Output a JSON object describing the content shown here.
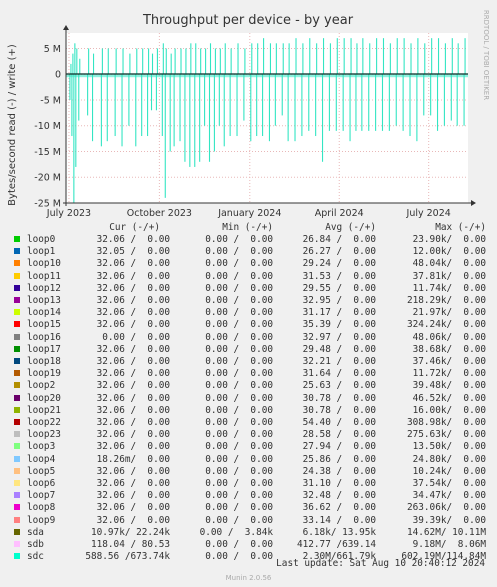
{
  "chart_data": {
    "type": "area",
    "title": "Throughput per device - by year",
    "ylabel": "Bytes/second read (-) / write (+)",
    "side_label": "RRDTOOL / TOBI OETIKER",
    "ylim": [
      -25000000,
      8000000
    ],
    "y_ticks": [
      {
        "value": 5000000,
        "label": "5 M"
      },
      {
        "value": 0,
        "label": "0"
      },
      {
        "value": -5000000,
        "label": "-5 M"
      },
      {
        "value": -10000000,
        "label": "-10 M"
      },
      {
        "value": -15000000,
        "label": "-15 M"
      },
      {
        "value": -20000000,
        "label": "-20 M"
      },
      {
        "value": -25000000,
        "label": "-25 M"
      }
    ],
    "x_ticks": [
      {
        "date": "2023-07-01",
        "label": "July 2023"
      },
      {
        "date": "2023-10-01",
        "label": "October 2023"
      },
      {
        "date": "2024-01-01",
        "label": "January 2024"
      },
      {
        "date": "2024-04-01",
        "label": "April 2024"
      },
      {
        "date": "2024-07-01",
        "label": "July 2024"
      }
    ],
    "x_range": [
      "2023-06-28",
      "2024-08-10"
    ],
    "series_color": "#33e5c3",
    "series": [
      {
        "name": "sdc",
        "dates": [
          "2023-07-02",
          "2023-07-04",
          "2023-07-06",
          "2023-07-08",
          "2023-07-11",
          "2023-07-20",
          "2023-07-25",
          "2023-08-03",
          "2023-08-09",
          "2023-08-17",
          "2023-08-24",
          "2023-08-31",
          "2023-09-07",
          "2023-09-13",
          "2023-09-19",
          "2023-09-23",
          "2023-09-28",
          "2023-10-04",
          "2023-10-07",
          "2023-10-12",
          "2023-10-16",
          "2023-10-22",
          "2023-10-27",
          "2023-11-01",
          "2023-11-06",
          "2023-11-11",
          "2023-11-16",
          "2023-11-21",
          "2023-11-26",
          "2023-12-01",
          "2023-12-06",
          "2023-12-12",
          "2023-12-19",
          "2023-12-26",
          "2024-01-02",
          "2024-01-08",
          "2024-01-14",
          "2024-01-21",
          "2024-01-27",
          "2024-02-03",
          "2024-02-09",
          "2024-02-16",
          "2024-02-23",
          "2024-03-01",
          "2024-03-08",
          "2024-03-15",
          "2024-03-22",
          "2024-03-29",
          "2024-04-05",
          "2024-04-12",
          "2024-04-18",
          "2024-04-24",
          "2024-05-01",
          "2024-05-08",
          "2024-05-15",
          "2024-05-22",
          "2024-05-29",
          "2024-06-05",
          "2024-06-12",
          "2024-06-19",
          "2024-06-26",
          "2024-07-03",
          "2024-07-10",
          "2024-07-17",
          "2024-07-24",
          "2024-07-30",
          "2024-08-06"
        ],
        "read": [
          -5000000,
          -12000000,
          -25000000,
          -18000000,
          -9000000,
          -8000000,
          -13000000,
          -14000000,
          -13000000,
          -12000000,
          -14000000,
          -10000000,
          -14000000,
          -12000000,
          -12000000,
          -7000000,
          -7000000,
          -12000000,
          -24000000,
          -15000000,
          -14000000,
          -13000000,
          -17000000,
          -18000000,
          -18000000,
          -17000000,
          -10000000,
          -17000000,
          -15000000,
          -10000000,
          -14000000,
          -12000000,
          -12000000,
          -9000000,
          -13000000,
          -12000000,
          -12000000,
          -13000000,
          -10000000,
          -8000000,
          -13000000,
          -13000000,
          -12000000,
          -11000000,
          -12000000,
          -17000000,
          -11000000,
          -11000000,
          -11000000,
          -13000000,
          -11000000,
          -11000000,
          -11000000,
          -11000000,
          -11000000,
          -11000000,
          -10000000,
          -11000000,
          -12000000,
          -13000000,
          -8000000,
          -8000000,
          -11000000,
          -10000000,
          -9000000,
          -10000000,
          -10000000
        ],
        "write": [
          2000000,
          4000000,
          6000000,
          5000000,
          3000000,
          5000000,
          4000000,
          5000000,
          5000000,
          5000000,
          5000000,
          4000000,
          5000000,
          5000000,
          5000000,
          4000000,
          5000000,
          6000000,
          5000000,
          4000000,
          5000000,
          5000000,
          5000000,
          6000000,
          6000000,
          5000000,
          5000000,
          6000000,
          5000000,
          5000000,
          6000000,
          5000000,
          6000000,
          5000000,
          6000000,
          6000000,
          7000000,
          6000000,
          6000000,
          6000000,
          6000000,
          7000000,
          6000000,
          7000000,
          6000000,
          7000000,
          6000000,
          7000000,
          7000000,
          7000000,
          6000000,
          7000000,
          6000000,
          7000000,
          7000000,
          6000000,
          7000000,
          7000000,
          6000000,
          7000000,
          6000000,
          7000000,
          7000000,
          6000000,
          7000000,
          6000000,
          7000000
        ]
      }
    ]
  },
  "legend": {
    "headers": {
      "cur": "Cur (-/+)",
      "min": "Min (-/+)",
      "avg": "Avg (-/+)",
      "max": "Max (-/+)"
    },
    "rows": [
      {
        "name": "loop0",
        "color": "#00cc00",
        "cur": "32.06 /  0.00",
        "min": "0.00 /  0.00",
        "avg": "26.84 /  0.00",
        "max": "23.90k/  0.00"
      },
      {
        "name": "loop1",
        "color": "#0066b3",
        "cur": "32.05 /  0.00",
        "min": "0.00 /  0.00",
        "avg": "26.27 /  0.00",
        "max": "12.00k/  0.00"
      },
      {
        "name": "loop10",
        "color": "#ff8000",
        "cur": "32.06 /  0.00",
        "min": "0.00 /  0.00",
        "avg": "29.24 /  0.00",
        "max": "48.04k/  0.00"
      },
      {
        "name": "loop11",
        "color": "#ffcc00",
        "cur": "32.06 /  0.00",
        "min": "0.00 /  0.00",
        "avg": "31.53 /  0.00",
        "max": "37.81k/  0.00"
      },
      {
        "name": "loop12",
        "color": "#330099",
        "cur": "32.06 /  0.00",
        "min": "0.00 /  0.00",
        "avg": "29.55 /  0.00",
        "max": "11.74k/  0.00"
      },
      {
        "name": "loop13",
        "color": "#990099",
        "cur": "32.06 /  0.00",
        "min": "0.00 /  0.00",
        "avg": "32.95 /  0.00",
        "max": "218.29k/  0.00"
      },
      {
        "name": "loop14",
        "color": "#ccff00",
        "cur": "32.06 /  0.00",
        "min": "0.00 /  0.00",
        "avg": "31.17 /  0.00",
        "max": "21.97k/  0.00"
      },
      {
        "name": "loop15",
        "color": "#ff0000",
        "cur": "32.06 /  0.00",
        "min": "0.00 /  0.00",
        "avg": "35.39 /  0.00",
        "max": "324.24k/  0.00"
      },
      {
        "name": "loop16",
        "color": "#808080",
        "cur": "0.00 /  0.00",
        "min": "0.00 /  0.00",
        "avg": "32.97 /  0.00",
        "max": "48.06k/  0.00"
      },
      {
        "name": "loop17",
        "color": "#008f00",
        "cur": "32.06 /  0.00",
        "min": "0.00 /  0.00",
        "avg": "29.48 /  0.00",
        "max": "38.68k/  0.00"
      },
      {
        "name": "loop18",
        "color": "#00487d",
        "cur": "32.06 /  0.00",
        "min": "0.00 /  0.00",
        "avg": "32.21 /  0.00",
        "max": "37.46k/  0.00"
      },
      {
        "name": "loop19",
        "color": "#b35a00",
        "cur": "32.06 /  0.00",
        "min": "0.00 /  0.00",
        "avg": "31.64 /  0.00",
        "max": "11.72k/  0.00"
      },
      {
        "name": "loop2",
        "color": "#b38f00",
        "cur": "32.06 /  0.00",
        "min": "0.00 /  0.00",
        "avg": "25.63 /  0.00",
        "max": "39.48k/  0.00"
      },
      {
        "name": "loop20",
        "color": "#6b006b",
        "cur": "32.06 /  0.00",
        "min": "0.00 /  0.00",
        "avg": "30.78 /  0.00",
        "max": "46.52k/  0.00"
      },
      {
        "name": "loop21",
        "color": "#8fb300",
        "cur": "32.06 /  0.00",
        "min": "0.00 /  0.00",
        "avg": "30.78 /  0.00",
        "max": "16.00k/  0.00"
      },
      {
        "name": "loop22",
        "color": "#b30000",
        "cur": "32.06 /  0.00",
        "min": "0.00 /  0.00",
        "avg": "54.40 /  0.00",
        "max": "308.98k/  0.00"
      },
      {
        "name": "loop23",
        "color": "#bebebe",
        "cur": "32.06 /  0.00",
        "min": "0.00 /  0.00",
        "avg": "28.58 /  0.00",
        "max": "275.63k/  0.00"
      },
      {
        "name": "loop3",
        "color": "#80ff80",
        "cur": "32.06 /  0.00",
        "min": "0.00 /  0.00",
        "avg": "27.94 /  0.00",
        "max": "13.50k/  0.00"
      },
      {
        "name": "loop4",
        "color": "#80c9ff",
        "cur": "18.26m/  0.00",
        "min": "0.00 /  0.00",
        "avg": "25.86 /  0.00",
        "max": "24.80k/  0.00"
      },
      {
        "name": "loop5",
        "color": "#ffc080",
        "cur": "32.06 /  0.00",
        "min": "0.00 /  0.00",
        "avg": "24.38 /  0.00",
        "max": "10.24k/  0.00"
      },
      {
        "name": "loop6",
        "color": "#ffe680",
        "cur": "32.06 /  0.00",
        "min": "0.00 /  0.00",
        "avg": "31.10 /  0.00",
        "max": "37.54k/  0.00"
      },
      {
        "name": "loop7",
        "color": "#aa80ff",
        "cur": "32.06 /  0.00",
        "min": "0.00 /  0.00",
        "avg": "32.48 /  0.00",
        "max": "34.47k/  0.00"
      },
      {
        "name": "loop8",
        "color": "#ee00cc",
        "cur": "32.06 /  0.00",
        "min": "0.00 /  0.00",
        "avg": "36.62 /  0.00",
        "max": "263.06k/  0.00"
      },
      {
        "name": "loop9",
        "color": "#ff8080",
        "cur": "32.06 /  0.00",
        "min": "0.00 /  0.00",
        "avg": "33.14 /  0.00",
        "max": "39.39k/  0.00"
      },
      {
        "name": "sda",
        "color": "#666600",
        "cur": "10.97k/ 22.24k",
        "min": "0.00 /  3.84k",
        "avg": "6.18k/ 13.95k",
        "max": "14.62M/ 10.11M"
      },
      {
        "name": "sdb",
        "color": "#ffbfff",
        "cur": "118.04 / 80.53",
        "min": "0.00 /  0.00",
        "avg": "412.77 /639.14",
        "max": "9.18M/  8.06M"
      },
      {
        "name": "sdc",
        "color": "#00ffcc",
        "cur": "588.56 /673.74k",
        "min": "0.00 /  0.00",
        "avg": "2.30M/661.79k",
        "max": "602.19M/114.84M"
      }
    ]
  },
  "footer": {
    "last_update": "Last update: Sat Aug 10 20:40:12 2024",
    "version": "Munin 2.0.56"
  }
}
